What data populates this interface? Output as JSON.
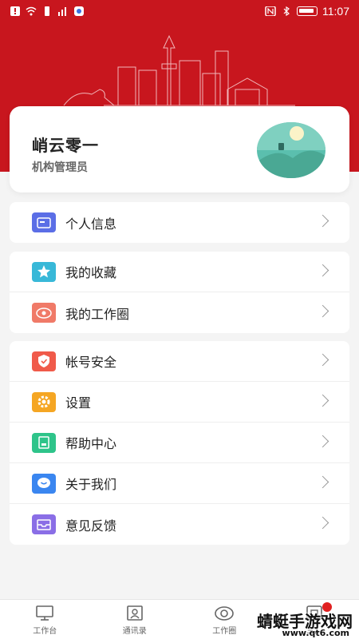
{
  "status_bar": {
    "time": "11:07"
  },
  "profile": {
    "name": "峭云零一",
    "role": "机构管理员"
  },
  "groups": [
    [
      {
        "label": "个人信息",
        "icon": "id-card-icon",
        "color": "#5b6ee6"
      }
    ],
    [
      {
        "label": "我的收藏",
        "icon": "star-icon",
        "color": "#38b8d8"
      },
      {
        "label": "我的工作圈",
        "icon": "eye-icon",
        "color": "#f07a68"
      }
    ],
    [
      {
        "label": "帐号安全",
        "icon": "shield-icon",
        "color": "#f05a4a"
      },
      {
        "label": "设置",
        "icon": "gear-icon",
        "color": "#f5a623"
      },
      {
        "label": "帮助中心",
        "icon": "book-icon",
        "color": "#2ec48a"
      },
      {
        "label": "关于我们",
        "icon": "chat-icon",
        "color": "#3a86f0"
      },
      {
        "label": "意见反馈",
        "icon": "inbox-icon",
        "color": "#8a6ee6"
      }
    ]
  ],
  "tabs": [
    {
      "label": "工作台",
      "icon": "monitor-icon"
    },
    {
      "label": "通讯录",
      "icon": "contacts-icon"
    },
    {
      "label": "工作圈",
      "icon": "eye-icon"
    },
    {
      "label": "三...",
      "icon": "app-icon"
    }
  ],
  "watermark": {
    "title": "蜻蜓手游戏网",
    "url": "www.qt6.com"
  },
  "colors": {
    "brand": "#c8161e",
    "background": "#f4f4f4"
  }
}
